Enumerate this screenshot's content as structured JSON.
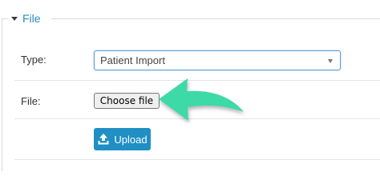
{
  "section": {
    "legend": "File",
    "legend_icon": "caret-down-icon"
  },
  "form": {
    "type_label": "Type:",
    "type_value": "Patient Import",
    "file_label": "File:",
    "choose_file_label": "Choose file",
    "upload_label": "Upload",
    "upload_icon": "upload-icon"
  },
  "annotation": {
    "arrow_icon": "green-arrow-icon",
    "arrow_color": "#3ed9a6"
  },
  "colors": {
    "accent": "#1f8fc4",
    "legend": "#2b8cbf"
  }
}
